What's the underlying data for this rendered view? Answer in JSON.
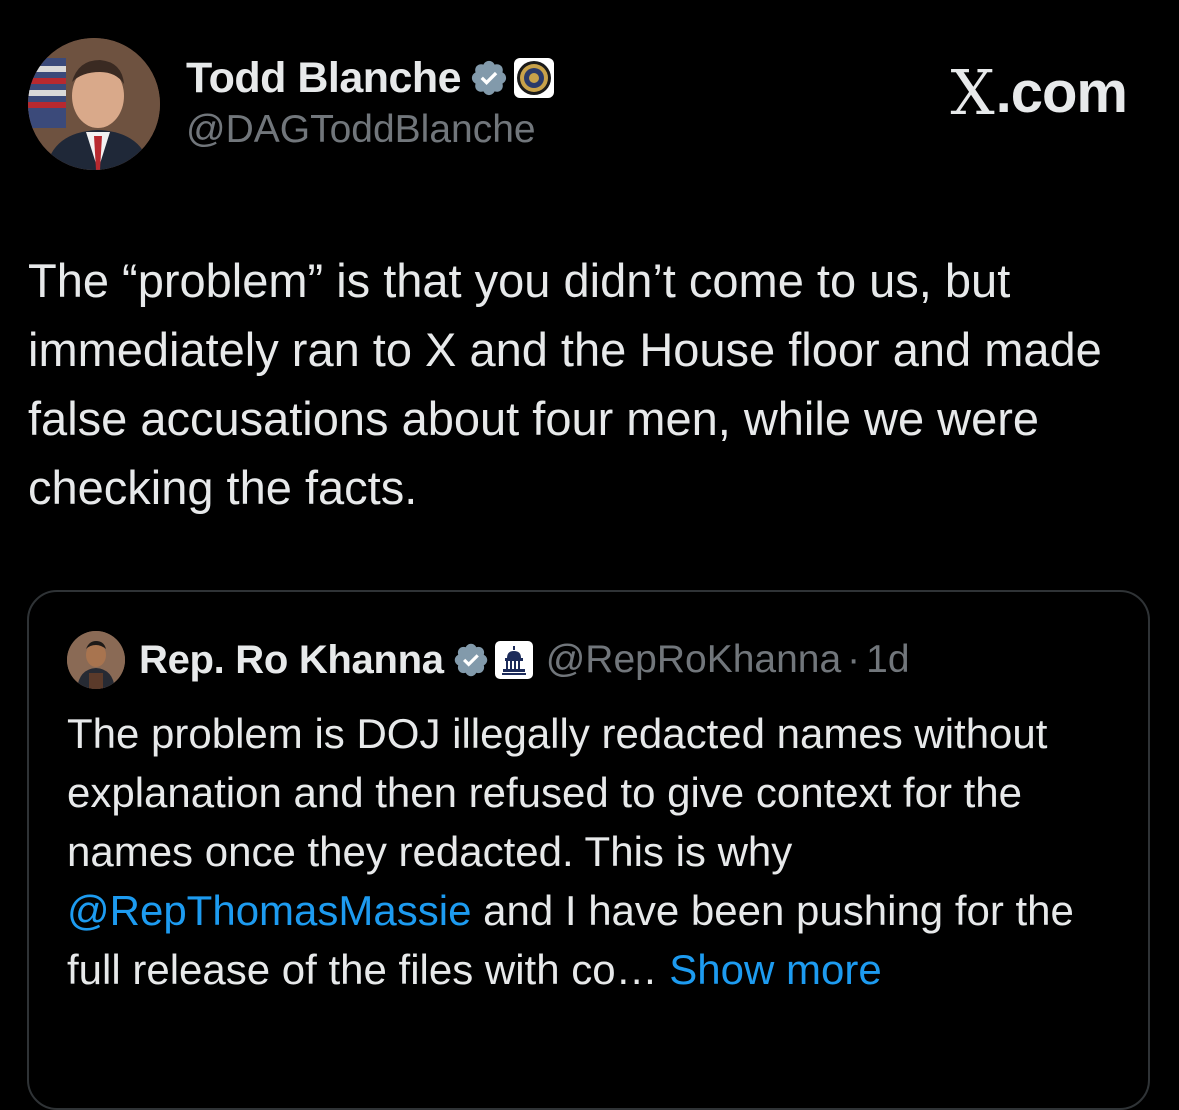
{
  "colors": {
    "background": "#000000",
    "text": "#e7e9ea",
    "muted": "#71767b",
    "link": "#1d9bf0",
    "verified_badge": "#829aab",
    "card_border": "#2f3336"
  },
  "tweet": {
    "author_name": "Todd Blanche",
    "author_handle": "@DAGToddBlanche",
    "verified_icon": "verified-badge-icon",
    "affiliation_icon": "doj-seal-icon",
    "text": "The “problem” is that you didn’t come to us, but immediately ran to X and the House floor and made false accusations about four men, while we were checking the facts."
  },
  "site_mark": {
    "x": "X",
    "domain": ".com"
  },
  "quoted_tweet": {
    "author_name": "Rep. Ro Khanna",
    "author_handle": "@RepRoKhanna",
    "separator": "·",
    "time": "1d",
    "verified_icon": "verified-badge-icon",
    "affiliation_icon": "house-democrats-icon",
    "text_before_mention": "The problem is DOJ illegally redacted names without explanation and then refused to give context for the names once they redacted. This is why ",
    "mention": "@RepThomasMassie",
    "text_after_mention": " and I have been pushing for the full release of the files with co… ",
    "show_more": "Show more"
  }
}
